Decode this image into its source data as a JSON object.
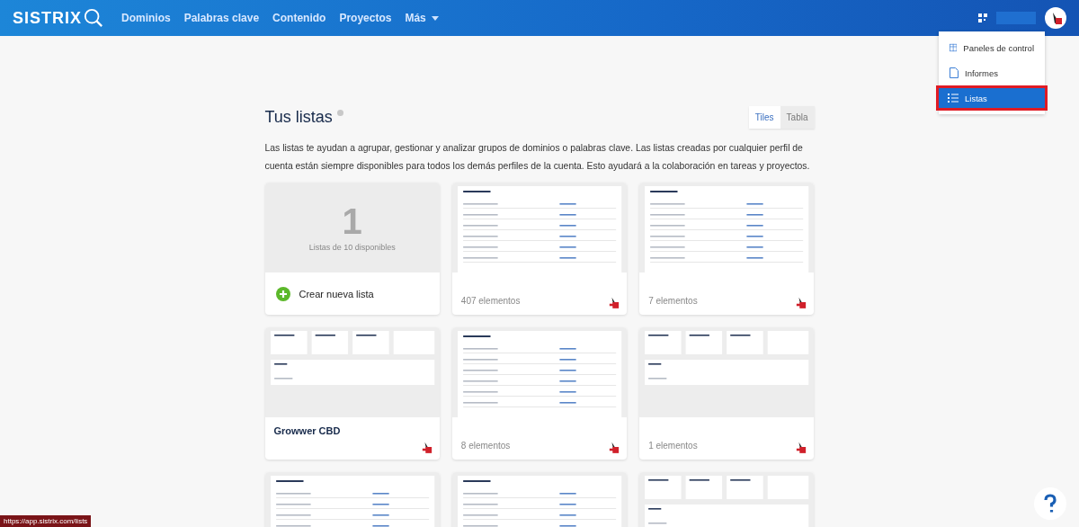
{
  "header": {
    "logo": "SISTRIX",
    "nav": [
      {
        "label": "Dominios",
        "dropdown": false
      },
      {
        "label": "Palabras clave",
        "dropdown": false
      },
      {
        "label": "Contenido",
        "dropdown": false
      },
      {
        "label": "Proyectos",
        "dropdown": false
      },
      {
        "label": "Más",
        "dropdown": true
      }
    ]
  },
  "user_menu": {
    "items": [
      {
        "label": "Paneles de control",
        "selected": false
      },
      {
        "label": "Informes",
        "selected": false
      },
      {
        "label": "Listas",
        "selected": true
      }
    ]
  },
  "page": {
    "title": "Tus listas",
    "view_toggle": [
      {
        "label": "Tiles",
        "selected": true
      },
      {
        "label": "Tabla",
        "selected": false
      }
    ],
    "description": "Las listas te ayudan a agrupar, gestionar y analizar grupos de dominios o palabras clave. Las listas creadas por cualquier perfil de cuenta están siempre disponibles para todos los demás perfiles de la cuenta. Esto ayudará a la colaboración en tareas y proyectos."
  },
  "cards": [
    {
      "kind": "create",
      "count": "1",
      "available": "Listas de 10 disponibles",
      "action": "Crear nueva lista"
    },
    {
      "kind": "table",
      "footer": "407 elementos"
    },
    {
      "kind": "table",
      "footer": "7 elementos"
    },
    {
      "kind": "dashboard",
      "title": "Growwer CBD"
    },
    {
      "kind": "table",
      "footer": "8 elementos"
    },
    {
      "kind": "dashboard",
      "footer": "1 elementos"
    },
    {
      "kind": "table"
    },
    {
      "kind": "table"
    },
    {
      "kind": "dashboard"
    }
  ],
  "status_bar": "https://app.sistrix.com/lists"
}
